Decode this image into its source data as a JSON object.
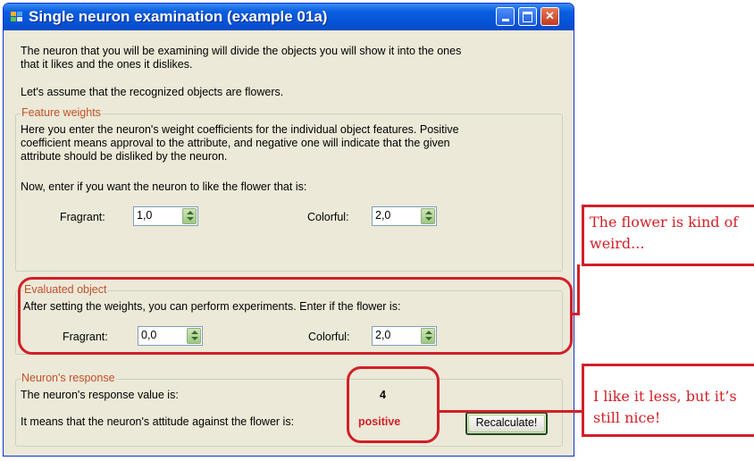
{
  "window": {
    "title": "Single neuron examination (example 01a)"
  },
  "intro": {
    "line1": "The neuron that you will be examining will divide the objects you will show it into the ones",
    "line2": "that it likes and the ones it dislikes.",
    "line3": "Let's assume that the recognized objects are flowers."
  },
  "weights": {
    "legend": "Feature weights",
    "desc1": "Here you enter the neuron's weight coefficients for the individual object features. Positive",
    "desc2": "coefficient means approval to the attribute, and negative one will indicate that the given",
    "desc3": "attribute should be disliked by the neuron.",
    "prompt": "Now, enter if you want the neuron to like the flower that is:",
    "fragrant_label": "Fragrant:",
    "fragrant_value": "1,0",
    "colorful_label": "Colorful:",
    "colorful_value": "2,0"
  },
  "object": {
    "legend": "Evaluated object",
    "desc": "After setting the weights, you can perform experiments. Enter if the flower is:",
    "fragrant_label": "Fragrant:",
    "fragrant_value": "0,0",
    "colorful_label": "Colorful:",
    "colorful_value": "2,0"
  },
  "response": {
    "legend": "Neuron's response",
    "value_label": "The neuron's response value is:",
    "value": "4",
    "attitude_label": "It means that the neuron's attitude against the flower is:",
    "attitude": "positive",
    "recalculate": "Recalculate!"
  },
  "annotations": {
    "callout1_line1": "The flower is kind of",
    "callout1_line2": "weird...",
    "callout2_line1": "I like it less, but it’s",
    "callout2_line2": "still nice!"
  },
  "colors": {
    "accent": "#d21f27",
    "titlebar": "#0553d6",
    "legend": "#c1502a",
    "window": "#ece9d8"
  }
}
